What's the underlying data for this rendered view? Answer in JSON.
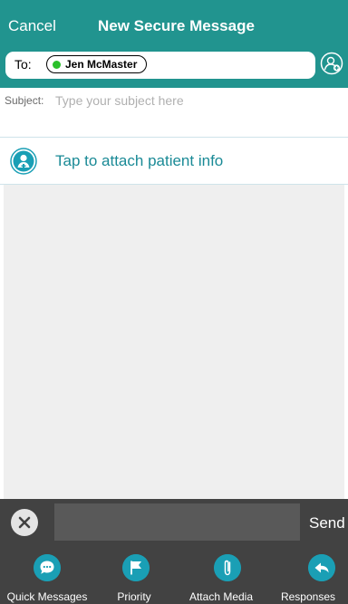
{
  "header": {
    "cancel_label": "Cancel",
    "title": "New Secure Message",
    "to_label": "To:",
    "recipient_name": "Jen McMaster",
    "recipient_status_color": "#2bc02b",
    "add_recipient_icon": "add-person-icon"
  },
  "subject": {
    "label": "Subject:",
    "placeholder": "Type your subject here"
  },
  "attach_patient": {
    "icon": "patient-icon",
    "label": "Tap to attach patient info"
  },
  "compose": {
    "clear_icon": "close-icon",
    "send_label": "Send"
  },
  "toolbar": {
    "items": [
      {
        "label": "Quick Messages",
        "icon": "chat-bubble-icon"
      },
      {
        "label": "Priority",
        "icon": "flag-icon"
      },
      {
        "label": "Attach Media",
        "icon": "paperclip-icon"
      },
      {
        "label": "Responses",
        "icon": "reply-arrow-icon"
      }
    ]
  },
  "colors": {
    "header_bg": "#21948f",
    "accent": "#1a9fb5",
    "toolbar_bg": "#424242"
  }
}
